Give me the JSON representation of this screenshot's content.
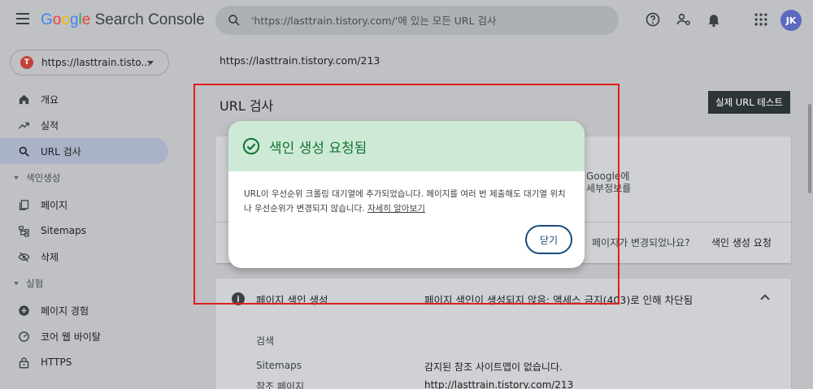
{
  "header": {
    "logo_parts": [
      "G",
      "o",
      "o",
      "g",
      "l",
      "e"
    ],
    "logo_rest": " Search Console",
    "search_placeholder": "'https://lasttrain.tistory.com/'에 있는 모든 URL 검사",
    "avatar_initials": "JK"
  },
  "sidebar": {
    "property_label": "https://lasttrain.tisto...",
    "property_icon_letter": "T",
    "items_top": [
      {
        "label": "개요",
        "icon": "home-icon"
      },
      {
        "label": "실적",
        "icon": "trending-icon"
      },
      {
        "label": "URL 검사",
        "icon": "search-icon",
        "active": true
      }
    ],
    "section_indexing": "색인생성",
    "items_indexing": [
      {
        "label": "페이지",
        "icon": "pages-icon"
      },
      {
        "label": "Sitemaps",
        "icon": "sitemap-icon"
      },
      {
        "label": "삭제",
        "icon": "removal-icon"
      }
    ],
    "section_experience": "실험",
    "items_experience": [
      {
        "label": "페이지 경험",
        "icon": "plus-circle-icon"
      },
      {
        "label": "코어 웹 바이탈",
        "icon": "gauge-icon"
      },
      {
        "label": "HTTPS",
        "icon": "lock-icon"
      }
    ]
  },
  "main": {
    "inspected_url": "https://lasttrain.tistory.com/213",
    "page_title": "URL 검사",
    "live_test_label": "실제 URL 테스트",
    "card1": {
      "partial_line1": "Google에",
      "partial_line2": "세부정보를",
      "question": "페이지가 변경되었나요?",
      "request_link": "색인 생성 요청"
    },
    "card2": {
      "section_title": "페이지 색인 생성",
      "section_status": "페이지 색인이 생성되지 않음: 액세스 금지(403)로 인해 차단됨",
      "rows": [
        {
          "label": "검색",
          "value": ""
        },
        {
          "label": "Sitemaps",
          "value": "감지된 참조 사이트맵이 없습니다."
        },
        {
          "label": "참조 페이지",
          "value": "http://lasttrain.tistory.com/213"
        }
      ]
    }
  },
  "dialog": {
    "title": "색인 생성 요청됨",
    "body": "URL이 우선순위 크롤링 대기열에 추가되었습니다. 페이지를 여러 번 제출해도 대기열 위치나 우선순위가 변경되지 않습니다. ",
    "learn_more": "자세히 알아보기",
    "close_label": "닫기"
  },
  "colors": {
    "overlay_bg": "#bfc1c5",
    "dialog_header": "#ceead6",
    "success_green": "#137333",
    "annotation_red": "#e01e1e",
    "button_blue": "#1a4a78"
  }
}
